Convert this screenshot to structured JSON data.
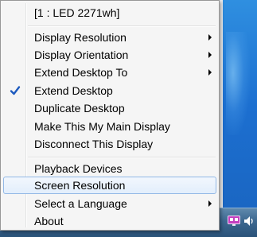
{
  "menu": {
    "header": "[1 : LED 2271wh]",
    "group1": [
      {
        "label": "Display Resolution",
        "submenu": true
      },
      {
        "label": "Display Orientation",
        "submenu": true
      },
      {
        "label": "Extend Desktop To",
        "submenu": true
      }
    ],
    "group2": [
      {
        "label": "Extend Desktop",
        "checked": true
      },
      {
        "label": "Duplicate Desktop"
      },
      {
        "label": "Make This My Main Display"
      },
      {
        "label": "Disconnect This Display"
      }
    ],
    "group3": [
      {
        "label": "Playback Devices"
      },
      {
        "label": "Screen Resolution",
        "highlighted": true
      },
      {
        "label": "Select a Language",
        "submenu": true
      },
      {
        "label": "About"
      }
    ]
  },
  "colors": {
    "highlight_border": "#92b8e6",
    "check_blue": "#1e5bbf",
    "desktop_blue": "#1c6fd0"
  },
  "tray": {
    "icons": [
      "display-tray-icon",
      "volume-icon"
    ]
  }
}
